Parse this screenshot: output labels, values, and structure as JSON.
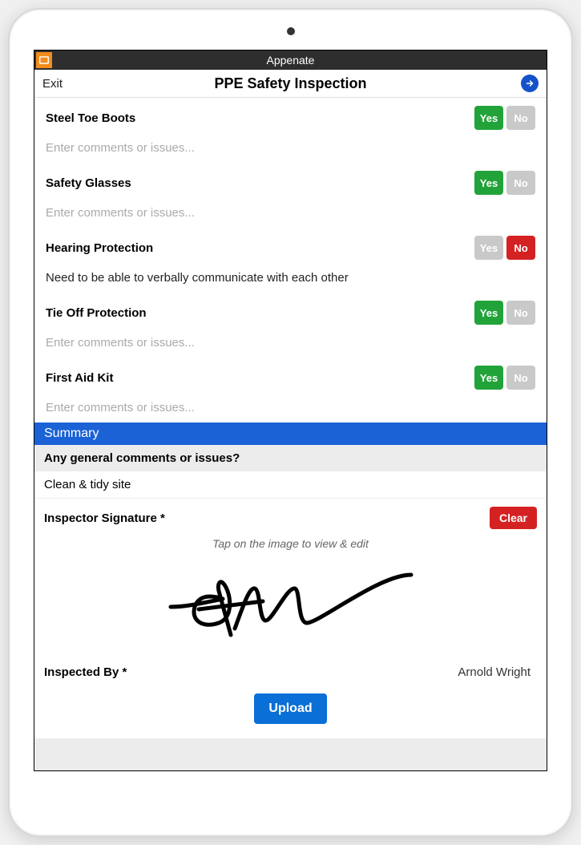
{
  "statusbar": {
    "app_name": "Appenate"
  },
  "navbar": {
    "exit": "Exit",
    "title": "PPE Safety Inspection"
  },
  "yes_label": "Yes",
  "no_label": "No",
  "comment_placeholder": "Enter comments or issues...",
  "items": [
    {
      "label": "Steel Toe Boots",
      "answer": "yes",
      "comment": ""
    },
    {
      "label": "Safety Glasses",
      "answer": "yes",
      "comment": ""
    },
    {
      "label": "Hearing Protection",
      "answer": "no",
      "comment": "Need to be able to verbally communicate with each other"
    },
    {
      "label": "Tie Off Protection",
      "answer": "yes",
      "comment": ""
    },
    {
      "label": "First Aid Kit",
      "answer": "yes",
      "comment": ""
    }
  ],
  "summary": {
    "header": "Summary",
    "question": "Any general comments or issues?",
    "answer": "Clean & tidy site"
  },
  "signature": {
    "label": "Inspector Signature *",
    "clear": "Clear",
    "hint": "Tap on the image to view & edit"
  },
  "inspected": {
    "label": "Inspected By *",
    "name": "Arnold Wright"
  },
  "upload_label": "Upload"
}
